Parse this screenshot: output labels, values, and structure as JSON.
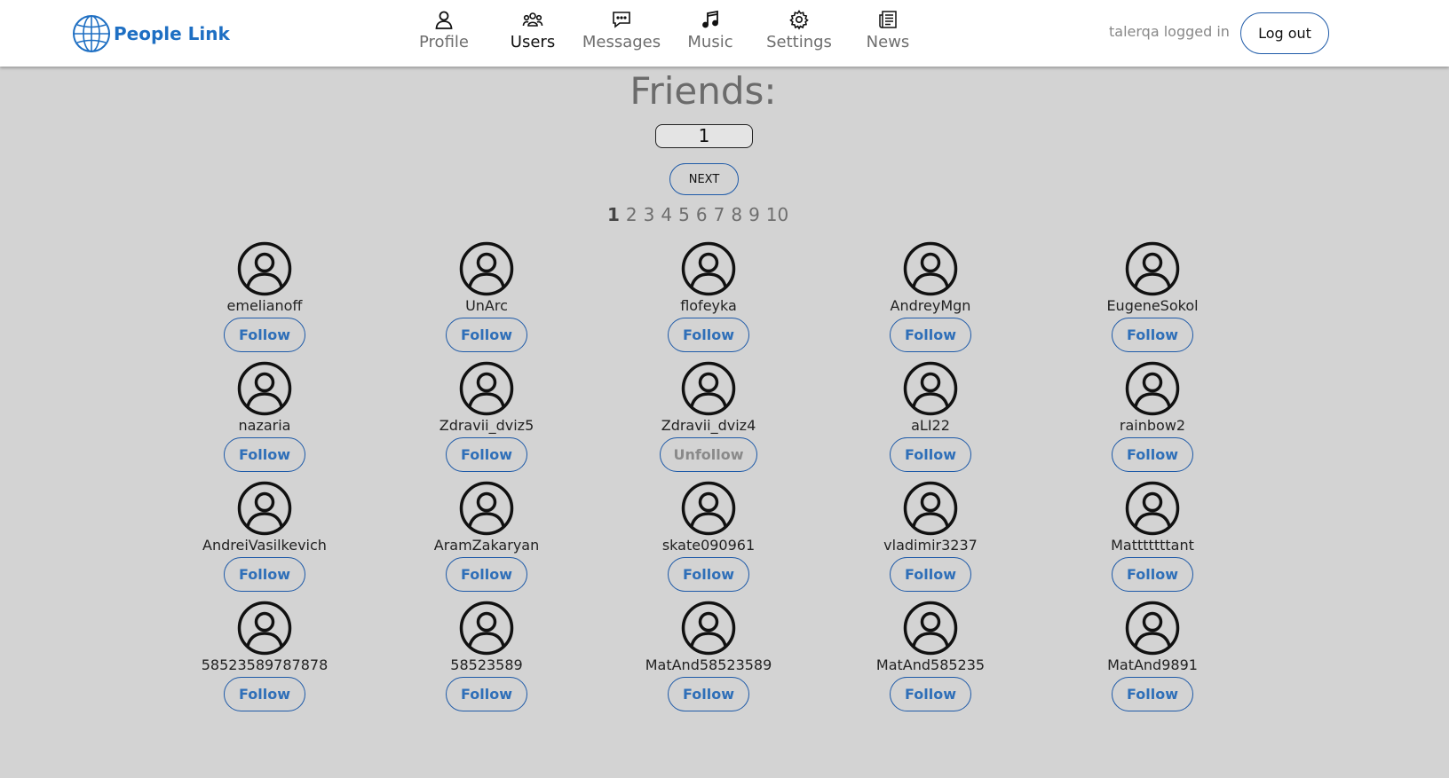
{
  "header": {
    "logo_text": "People Link",
    "nav": [
      {
        "label": "Profile",
        "icon": "person-icon"
      },
      {
        "label": "Users",
        "icon": "users-icon"
      },
      {
        "label": "Messages",
        "icon": "chat-icon"
      },
      {
        "label": "Music",
        "icon": "music-note-icon"
      },
      {
        "label": "Settings",
        "icon": "gear-icon"
      },
      {
        "label": "News",
        "icon": "newspaper-icon"
      }
    ],
    "active_nav": "Users",
    "user_status": "talerqa logged in",
    "logout_label": "Log out"
  },
  "main": {
    "title": "Friends:",
    "count_value": "1",
    "next_label": "NEXT",
    "pages": [
      "1",
      "2",
      "3",
      "4",
      "5",
      "6",
      "7",
      "8",
      "9",
      "10"
    ],
    "current_page": "1"
  },
  "users": [
    {
      "name": "emelianoff",
      "action": "Follow"
    },
    {
      "name": "UnArc",
      "action": "Follow"
    },
    {
      "name": "flofeyka",
      "action": "Follow"
    },
    {
      "name": "AndreyMgn",
      "action": "Follow"
    },
    {
      "name": "EugeneSokol",
      "action": "Follow"
    },
    {
      "name": "nazaria",
      "action": "Follow"
    },
    {
      "name": "Zdravii_dviz5",
      "action": "Follow"
    },
    {
      "name": "Zdravii_dviz4",
      "action": "Unfollow"
    },
    {
      "name": "aLI22",
      "action": "Follow"
    },
    {
      "name": "rainbow2",
      "action": "Follow"
    },
    {
      "name": "AndreiVasilkevich",
      "action": "Follow"
    },
    {
      "name": "AramZakaryan",
      "action": "Follow"
    },
    {
      "name": "skate090961",
      "action": "Follow"
    },
    {
      "name": "vladimir3237",
      "action": "Follow"
    },
    {
      "name": "Matttttttant",
      "action": "Follow"
    },
    {
      "name": "58523589787878",
      "action": "Follow"
    },
    {
      "name": "58523589",
      "action": "Follow"
    },
    {
      "name": "MatAnd58523589",
      "action": "Follow"
    },
    {
      "name": "MatAnd585235",
      "action": "Follow"
    },
    {
      "name": "MatAnd9891",
      "action": "Follow"
    }
  ],
  "colors": {
    "background": "#d3d3d3",
    "brand": "#1e6fc3",
    "button_border": "#1e5aa8",
    "follow_text": "#2f6fb8"
  }
}
